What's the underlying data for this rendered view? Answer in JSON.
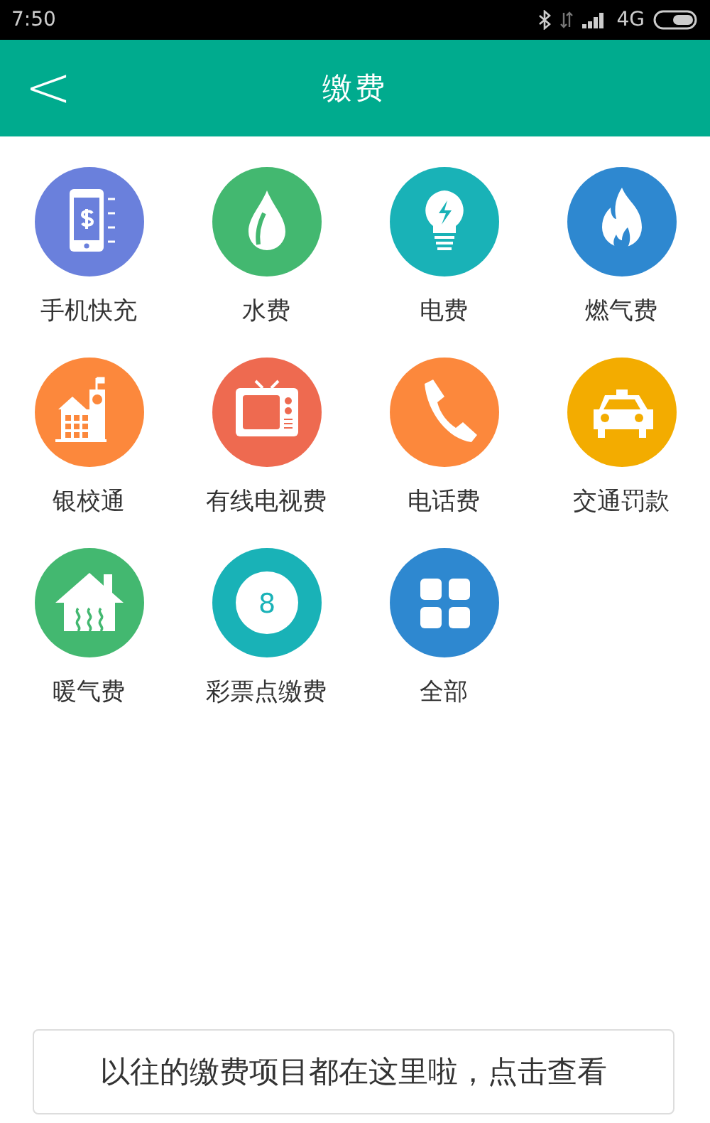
{
  "status_bar": {
    "time": "7:50",
    "network": "4G"
  },
  "header": {
    "back": "<",
    "title": "缴费"
  },
  "services": [
    {
      "label": "手机快充",
      "kind": "phone",
      "color": "#6a80dc"
    },
    {
      "label": "水费",
      "kind": "water",
      "color": "#43b870"
    },
    {
      "label": "电费",
      "kind": "bulb",
      "color": "#19b2b7"
    },
    {
      "label": "燃气费",
      "kind": "flame",
      "color": "#2e88d0"
    },
    {
      "label": "银校通",
      "kind": "school",
      "color": "#fc883c"
    },
    {
      "label": "有线电视费",
      "kind": "tv",
      "color": "#ee6a50"
    },
    {
      "label": "电话费",
      "kind": "call",
      "color": "#fc883c"
    },
    {
      "label": "交通罚款",
      "kind": "taxi",
      "color": "#f3ac00"
    },
    {
      "label": "暖气费",
      "kind": "heating",
      "color": "#43b870"
    },
    {
      "label": "彩票点缴费",
      "kind": "lottery",
      "color": "#19b2b7",
      "badge": "8"
    },
    {
      "label": "全部",
      "kind": "grid",
      "color": "#2e88d0"
    }
  ],
  "tip": {
    "text": "以往的缴费项目都在这里啦，点击查看"
  }
}
